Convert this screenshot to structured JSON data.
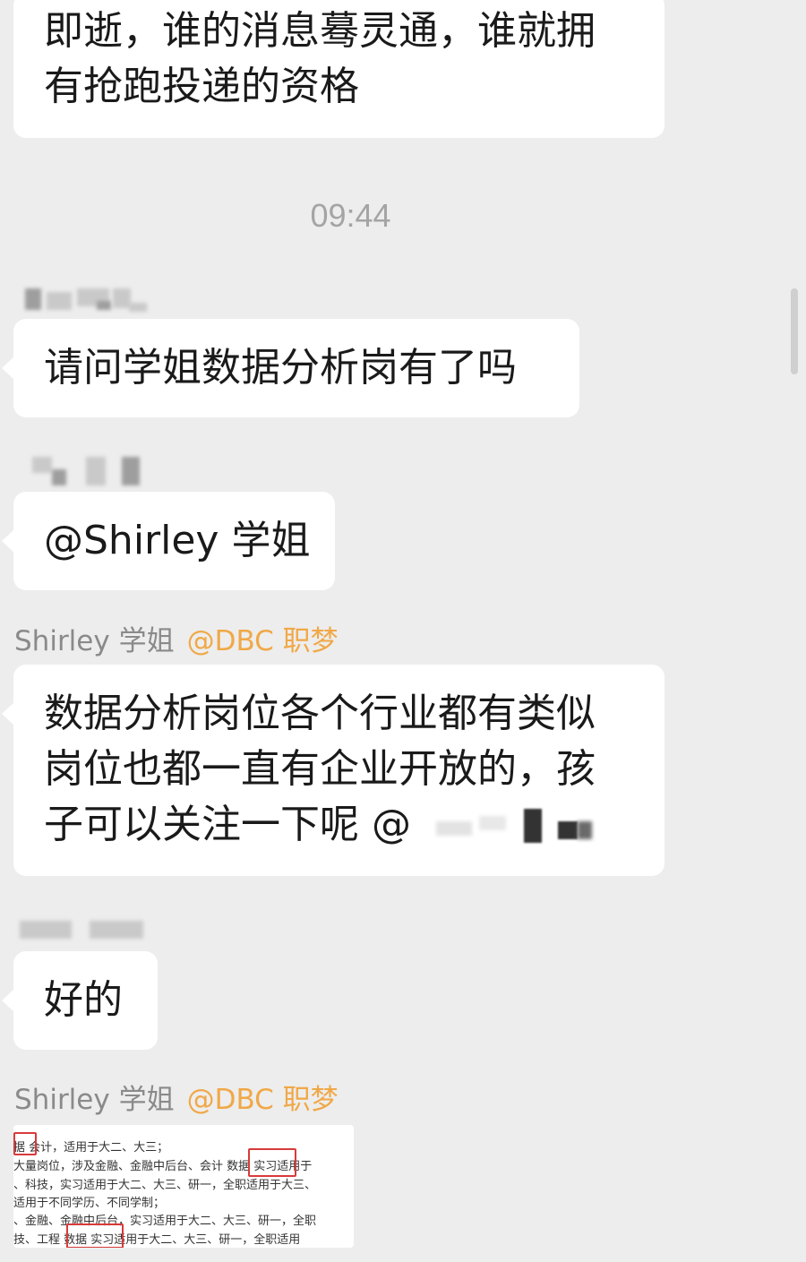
{
  "messages": {
    "m1": {
      "lines": [
        "即逝，谁的消息蓦灵通，谁就拥",
        "有抢跑投递的资格"
      ]
    },
    "timestamp": "09:44",
    "m2": {
      "text": "请问学姐数据分析岗有了吗"
    },
    "m3": {
      "text": "@Shirley 学姐"
    },
    "m4": {
      "sender": "Shirley 学姐",
      "tag": "@DBC 职梦",
      "lines": [
        "数据分析岗位各个行业都有类似",
        "岗位也都一直有企业开放的，孩",
        "子可以关注一下呢 @"
      ]
    },
    "m5": {
      "text": "好的"
    },
    "m6": {
      "sender": "Shirley 学姐",
      "tag": "@DBC 职梦",
      "image_lines": [
        "据  会计，适用于大二、大三；",
        "大量岗位，涉及金融、金融中后台、会计  数据  实习适用于",
        "、科技，实习适用于大二、大三、研一，全职适用于大三、",
        "适用于不同学历、不同学制；",
        "、金融、金融中后台，实习适用于大二、大三、研一，全职",
        "技、工程  数据  实习适用于大二、大三、研一，全职适用"
      ]
    }
  },
  "colors": {
    "background": "#ededed",
    "bubble": "#ffffff",
    "text": "#1a1a1a",
    "timestamp": "#a4a4a4",
    "sender_name": "#8a8a8a",
    "sender_tag": "#f0a847",
    "highlight_box": "#d83a3a"
  }
}
